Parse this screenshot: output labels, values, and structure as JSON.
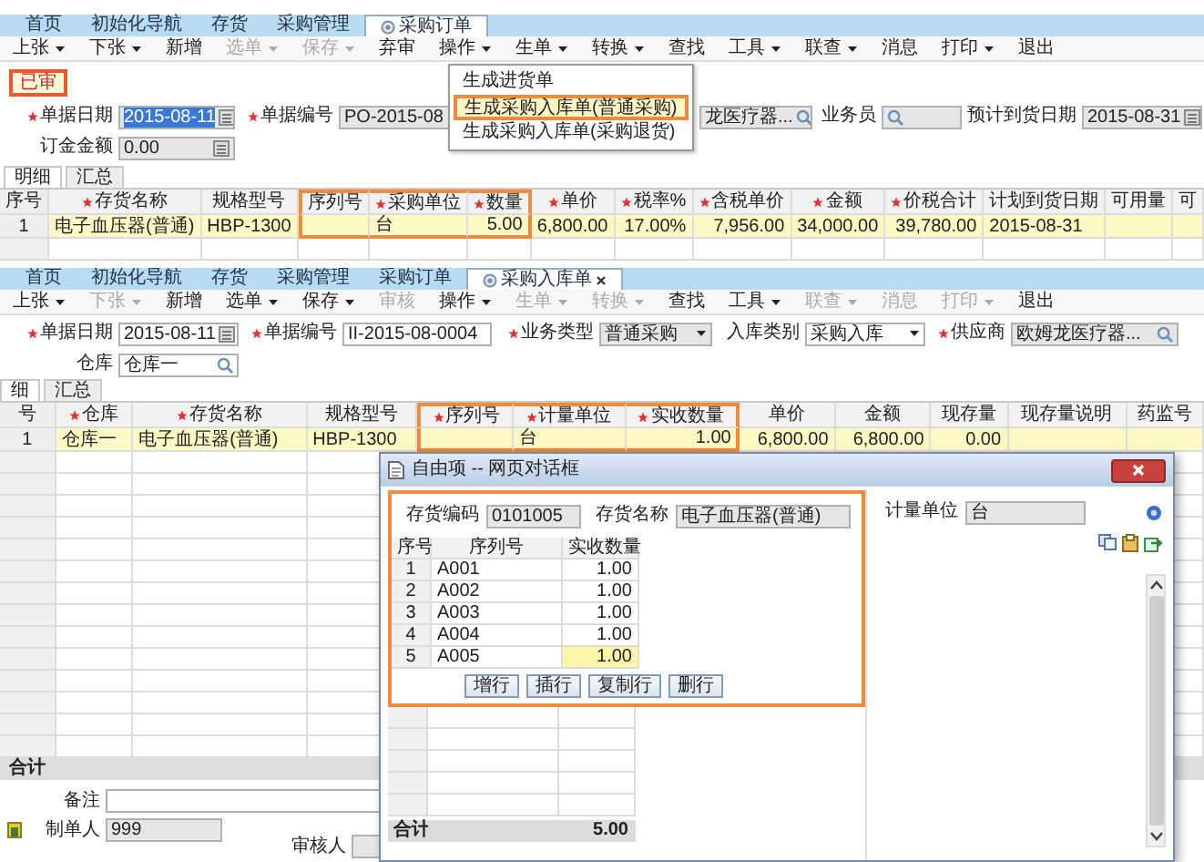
{
  "screens": [
    {
      "tabs": [
        {
          "label": "首页",
          "selected": false,
          "closable": false
        },
        {
          "label": "初始化导航",
          "selected": false,
          "closable": false
        },
        {
          "label": "存货",
          "selected": false,
          "closable": false
        },
        {
          "label": "采购管理",
          "selected": false,
          "closable": false
        },
        {
          "label": "采购订单",
          "selected": true,
          "closable": false
        }
      ],
      "toolbar": [
        {
          "label": "上张",
          "dropdown": true,
          "disabled": false
        },
        {
          "label": "下张",
          "dropdown": true,
          "disabled": false
        },
        {
          "label": "新增",
          "dropdown": false,
          "disabled": false
        },
        {
          "label": "选单",
          "dropdown": true,
          "disabled": true
        },
        {
          "label": "保存",
          "dropdown": true,
          "disabled": true
        },
        {
          "label": "弃审",
          "dropdown": false,
          "disabled": false
        },
        {
          "label": "操作",
          "dropdown": true,
          "disabled": false
        },
        {
          "label": "生单",
          "dropdown": true,
          "disabled": false
        },
        {
          "label": "转换",
          "dropdown": true,
          "disabled": false
        },
        {
          "label": "查找",
          "dropdown": false,
          "disabled": false
        },
        {
          "label": "工具",
          "dropdown": true,
          "disabled": false
        },
        {
          "label": "联查",
          "dropdown": true,
          "disabled": false
        },
        {
          "label": "消息",
          "dropdown": false,
          "disabled": false
        },
        {
          "label": "打印",
          "dropdown": true,
          "disabled": false
        },
        {
          "label": "退出",
          "dropdown": false,
          "disabled": false
        }
      ],
      "status_badge": "已审",
      "form_rows": [
        [
          {
            "label": "单据日期",
            "required": true,
            "value": "2015-08-11",
            "kind": "date",
            "readonly": true,
            "text_selected": true
          },
          {
            "label": "单据编号",
            "required": true,
            "value": "PO-2015-08",
            "kind": "text",
            "readonly": true,
            "text_selected": false
          },
          {
            "value": "龙医疗器...",
            "kind": "search",
            "readonly": true,
            "text_selected": false
          },
          {
            "label": "业务员",
            "required": false,
            "kind": "search",
            "readonly": true
          },
          {
            "label": "预计到货日期",
            "required": false,
            "value": "2015-08-31",
            "kind": "date",
            "readonly": true,
            "text_selected": false
          }
        ],
        [
          {
            "label": "订金金额",
            "required": false,
            "value": "0.00",
            "kind": "calc",
            "readonly": true,
            "text_selected": false
          }
        ]
      ],
      "detail_tabs": [
        {
          "label": "明细",
          "selected": true
        },
        {
          "label": "汇总",
          "selected": false
        }
      ],
      "table": {
        "columns": [
          {
            "label": "序号",
            "required": false,
            "kind": "index",
            "highlighted": false
          },
          {
            "label": "存货名称",
            "required": true,
            "kind": "text",
            "highlighted": false
          },
          {
            "label": "规格型号",
            "required": false,
            "kind": "text",
            "highlighted": false
          },
          {
            "label": "序列号",
            "required": false,
            "kind": "text",
            "highlighted": true
          },
          {
            "label": "采购单位",
            "required": true,
            "kind": "text",
            "highlighted": true
          },
          {
            "label": "数量",
            "required": true,
            "kind": "number",
            "highlighted": true
          },
          {
            "label": "单价",
            "required": true,
            "kind": "number",
            "highlighted": false
          },
          {
            "label": "税率%",
            "required": true,
            "kind": "number",
            "highlighted": false
          },
          {
            "label": "含税单价",
            "required": true,
            "kind": "number",
            "highlighted": false
          },
          {
            "label": "金额",
            "required": true,
            "kind": "number",
            "highlighted": false
          },
          {
            "label": "价税合计",
            "required": true,
            "kind": "number",
            "highlighted": false
          },
          {
            "label": "计划到货日期",
            "required": false,
            "kind": "text",
            "highlighted": false
          },
          {
            "label": "可用量",
            "required": false,
            "kind": "number",
            "highlighted": false
          },
          {
            "label": "可",
            "required": false,
            "kind": "number",
            "highlighted": false
          }
        ],
        "rows": [
          {
            "selected": true,
            "cells": [
              "1",
              "电子血压器(普通)",
              "HBP-1300",
              "",
              "台",
              "5.00",
              "6,800.00",
              "17.00%",
              "7,956.00",
              "34,000.00",
              "39,780.00",
              "2015-08-31",
              "",
              ""
            ]
          }
        ]
      },
      "menu": {
        "items": [
          {
            "label": "生成进货单",
            "highlighted": false
          },
          {
            "label": "生成采购入库单(普通采购)",
            "highlighted": true
          },
          {
            "label": "生成采购入库单(采购退货)",
            "highlighted": false
          }
        ]
      }
    },
    {
      "tabs": [
        {
          "label": "首页",
          "selected": false,
          "closable": false
        },
        {
          "label": "初始化导航",
          "selected": false,
          "closable": false
        },
        {
          "label": "存货",
          "selected": false,
          "closable": false
        },
        {
          "label": "采购管理",
          "selected": false,
          "closable": false
        },
        {
          "label": "采购订单",
          "selected": false,
          "closable": false
        },
        {
          "label": "采购入库单",
          "selected": true,
          "closable": true
        }
      ],
      "toolbar": [
        {
          "label": "上张",
          "dropdown": true,
          "disabled": false
        },
        {
          "label": "下张",
          "dropdown": true,
          "disabled": true
        },
        {
          "label": "新增",
          "dropdown": false,
          "disabled": false
        },
        {
          "label": "选单",
          "dropdown": true,
          "disabled": false
        },
        {
          "label": "保存",
          "dropdown": true,
          "disabled": false
        },
        {
          "label": "审核",
          "dropdown": false,
          "disabled": true
        },
        {
          "label": "操作",
          "dropdown": true,
          "disabled": false
        },
        {
          "label": "生单",
          "dropdown": true,
          "disabled": true
        },
        {
          "label": "转换",
          "dropdown": true,
          "disabled": true
        },
        {
          "label": "查找",
          "dropdown": false,
          "disabled": false
        },
        {
          "label": "工具",
          "dropdown": true,
          "disabled": false
        },
        {
          "label": "联查",
          "dropdown": true,
          "disabled": true
        },
        {
          "label": "消息",
          "dropdown": false,
          "disabled": true
        },
        {
          "label": "打印",
          "dropdown": true,
          "disabled": true
        },
        {
          "label": "退出",
          "dropdown": false,
          "disabled": false
        }
      ],
      "form_rows": [
        [
          {
            "label": "单据日期",
            "required": true,
            "value": "2015-08-11",
            "kind": "date",
            "readonly": false,
            "text_selected": false
          },
          {
            "label": "单据编号",
            "required": true,
            "value": "II-2015-08-0004",
            "kind": "text",
            "readonly": false,
            "text_selected": false
          },
          {
            "label": "业务类型",
            "required": true,
            "value": "普通采购",
            "kind": "select",
            "readonly": true,
            "text_selected": false
          },
          {
            "label": "入库类别",
            "required": false,
            "value": "采购入库",
            "kind": "select",
            "readonly": false,
            "text_selected": false
          },
          {
            "label": "供应商",
            "required": true,
            "value": "欧姆龙医疗器...",
            "kind": "search",
            "readonly": true,
            "text_selected": false
          }
        ],
        [
          {
            "label": "仓库",
            "required": false,
            "value": "仓库一",
            "kind": "search",
            "readonly": false,
            "text_selected": false
          }
        ]
      ],
      "detail_tabs": [
        {
          "label": "细",
          "selected": true
        },
        {
          "label": "汇总",
          "selected": false
        }
      ],
      "table": {
        "columns": [
          {
            "label": "号",
            "required": false,
            "kind": "index",
            "highlighted": false
          },
          {
            "label": "仓库",
            "required": true,
            "kind": "text",
            "highlighted": false
          },
          {
            "label": "存货名称",
            "required": true,
            "kind": "text",
            "highlighted": false
          },
          {
            "label": "规格型号",
            "required": false,
            "kind": "text",
            "highlighted": false
          },
          {
            "label": "序列号",
            "required": true,
            "kind": "text",
            "highlighted": true
          },
          {
            "label": "计量单位",
            "required": true,
            "kind": "text",
            "highlighted": true
          },
          {
            "label": "实收数量",
            "required": true,
            "kind": "number",
            "highlighted": true
          },
          {
            "label": "单价",
            "required": false,
            "kind": "number",
            "highlighted": false
          },
          {
            "label": "金额",
            "required": false,
            "kind": "number",
            "highlighted": false
          },
          {
            "label": "现存量",
            "required": false,
            "kind": "number",
            "highlighted": false
          },
          {
            "label": "现存量说明",
            "required": false,
            "kind": "text",
            "highlighted": false
          },
          {
            "label": "药监号",
            "required": false,
            "kind": "text",
            "highlighted": false
          }
        ],
        "rows": [
          {
            "selected": true,
            "cells": [
              "1",
              "仓库一",
              "电子血压器(普通)",
              "HBP-1300",
              "",
              "台",
              "1.00",
              "6,800.00",
              "6,800.00",
              "0.00",
              "",
              ""
            ]
          }
        ],
        "total_label": "合计"
      },
      "footer": [
        {
          "label": "备注",
          "readonly": false
        },
        {
          "label": "制单人",
          "value": "999",
          "readonly": true
        },
        {
          "label": "审核人",
          "readonly": true
        }
      ],
      "dialog": {
        "title": "自由项 -- 网页对话框",
        "fields": [
          {
            "label": "存货编码",
            "value": "0101005"
          },
          {
            "label": "存货名称",
            "value": "电子血压器(普通)"
          },
          {
            "label": "计量单位",
            "value": "台"
          }
        ],
        "columns": [
          "序号",
          "序列号",
          "实收数量"
        ],
        "rows": [
          {
            "selected": false,
            "cells": [
              "1",
              "A001",
              "1.00"
            ]
          },
          {
            "selected": false,
            "cells": [
              "2",
              "A002",
              "1.00"
            ]
          },
          {
            "selected": false,
            "cells": [
              "3",
              "A003",
              "1.00"
            ]
          },
          {
            "selected": false,
            "cells": [
              "4",
              "A004",
              "1.00"
            ]
          },
          {
            "selected": true,
            "cells": [
              "5",
              "A005",
              "1.00"
            ]
          }
        ],
        "buttons": [
          "增行",
          "插行",
          "复制行",
          "删行"
        ],
        "total": {
          "label": "合计",
          "value": "5.00"
        }
      }
    }
  ]
}
